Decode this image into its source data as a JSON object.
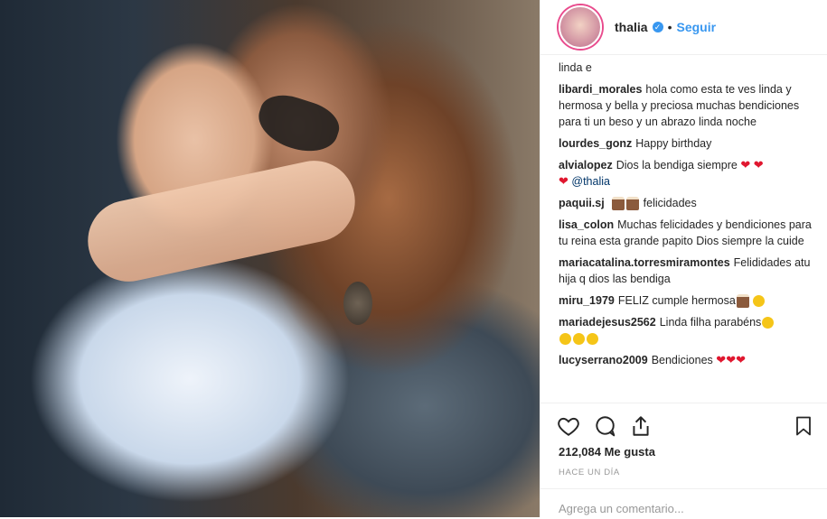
{
  "header": {
    "username": "thalia",
    "dot": "•",
    "follow": "Seguir"
  },
  "comments": [
    {
      "text": "linda e"
    },
    {
      "user": "libardi_morales",
      "text": "hola como esta te ves linda y hermosa y bella y preciosa muchas bendiciones para ti un beso y un abrazo linda noche"
    },
    {
      "user": "lourdes_gonz",
      "text": "Happy birthday"
    },
    {
      "user": "alvialopez",
      "text": "Dios la bendiga siempre",
      "mention": "@thalia"
    },
    {
      "user": "paquii.sj",
      "text": "felicidades"
    },
    {
      "user": "lisa_colon",
      "text": "Muchas felicidades y bendiciones para tu reina esta grande papito Dios siempre la cuide"
    },
    {
      "user": "mariacatalina.torresmiramontes",
      "text": "Felididades atu hija q dios las bendiga"
    },
    {
      "user": "miru_1979",
      "text": "FELIZ cumple hermosa"
    },
    {
      "user": "mariadejesus2562",
      "text": "Linda filha parabéns"
    },
    {
      "user": "lucyserrano2009",
      "text": "Bendiciones"
    }
  ],
  "post": {
    "likes": "212,084 Me gusta",
    "time": "HACE UN DÍA"
  },
  "add_comment": {
    "placeholder": "Agrega un comentario..."
  },
  "icons": {
    "like": "heart-icon",
    "comment": "comment-icon",
    "share": "share-icon",
    "save": "bookmark-icon"
  },
  "colors": {
    "link": "#3897f0",
    "heart": "#e0172f"
  }
}
